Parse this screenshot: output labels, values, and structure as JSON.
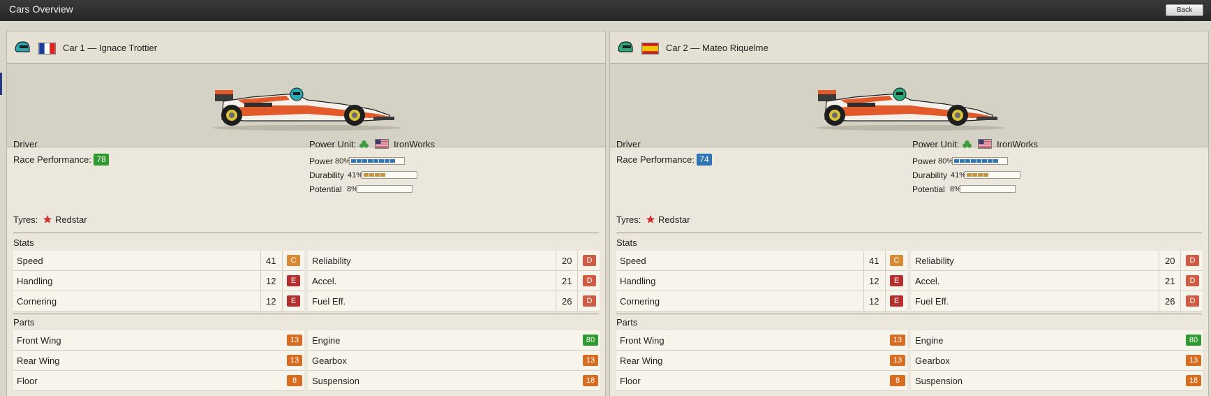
{
  "window": {
    "title": "Cars Overview",
    "back_label": "Back"
  },
  "colors": {
    "grade_C": "#d88933",
    "grade_D": "#cf5b45",
    "grade_E": "#b52f2f",
    "part_orange": "#d86d22",
    "part_green": "#2f9a2f",
    "power_bar": "#2f74b5",
    "durability_bar": "#c8913b"
  },
  "cars": [
    {
      "title": "Car 1 — Ignace Trottier",
      "flag": "france-flag",
      "helmet": "teal-helmet",
      "driver_label": "Driver",
      "race_perf_label": "Race Performance:",
      "race_perf_value": "78",
      "race_perf_color": "green",
      "power_unit_label": "Power Unit:",
      "power_unit_name": "IronWorks",
      "meters": [
        {
          "label": "Power",
          "pct": "80%",
          "fraction": 0.8,
          "kind": "power"
        },
        {
          "label": "Durability",
          "pct": "41%",
          "fraction": 0.41,
          "kind": "durability"
        },
        {
          "label": "Potential",
          "pct": "8%",
          "fraction": 0.08,
          "kind": "potential"
        }
      ],
      "tyres_label": "Tyres:",
      "tyres_name": "Redstar",
      "stats_label": "Stats",
      "stats_left": [
        {
          "name": "Speed",
          "value": "41",
          "grade": "C"
        },
        {
          "name": "Handling",
          "value": "12",
          "grade": "E"
        },
        {
          "name": "Cornering",
          "value": "12",
          "grade": "E"
        }
      ],
      "stats_right": [
        {
          "name": "Reliability",
          "value": "20",
          "grade": "D"
        },
        {
          "name": "Accel.",
          "value": "21",
          "grade": "D"
        },
        {
          "name": "Fuel Eff.",
          "value": "26",
          "grade": "D"
        }
      ],
      "parts_label": "Parts",
      "parts_left": [
        {
          "name": "Front Wing",
          "value": "13",
          "color": "orange"
        },
        {
          "name": "Rear Wing",
          "value": "13",
          "color": "orange"
        },
        {
          "name": "Floor",
          "value": "8",
          "color": "orange"
        }
      ],
      "parts_right": [
        {
          "name": "Engine",
          "value": "80",
          "color": "green"
        },
        {
          "name": "Gearbox",
          "value": "13",
          "color": "orange"
        },
        {
          "name": "Suspension",
          "value": "18",
          "color": "orange"
        }
      ]
    },
    {
      "title": "Car 2 — Mateo Riquelme",
      "flag": "spain-flag",
      "helmet": "green-helmet",
      "driver_label": "Driver",
      "race_perf_label": "Race Performance:",
      "race_perf_value": "74",
      "race_perf_color": "blue",
      "power_unit_label": "Power Unit:",
      "power_unit_name": "IronWorks",
      "meters": [
        {
          "label": "Power",
          "pct": "80%",
          "fraction": 0.8,
          "kind": "power"
        },
        {
          "label": "Durability",
          "pct": "41%",
          "fraction": 0.41,
          "kind": "durability"
        },
        {
          "label": "Potential",
          "pct": "8%",
          "fraction": 0.08,
          "kind": "potential"
        }
      ],
      "tyres_label": "Tyres:",
      "tyres_name": "Redstar",
      "stats_label": "Stats",
      "stats_left": [
        {
          "name": "Speed",
          "value": "41",
          "grade": "C"
        },
        {
          "name": "Handling",
          "value": "12",
          "grade": "E"
        },
        {
          "name": "Cornering",
          "value": "12",
          "grade": "E"
        }
      ],
      "stats_right": [
        {
          "name": "Reliability",
          "value": "20",
          "grade": "D"
        },
        {
          "name": "Accel.",
          "value": "21",
          "grade": "D"
        },
        {
          "name": "Fuel Eff.",
          "value": "26",
          "grade": "D"
        }
      ],
      "parts_label": "Parts",
      "parts_left": [
        {
          "name": "Front Wing",
          "value": "13",
          "color": "orange"
        },
        {
          "name": "Rear Wing",
          "value": "13",
          "color": "orange"
        },
        {
          "name": "Floor",
          "value": "8",
          "color": "orange"
        }
      ],
      "parts_right": [
        {
          "name": "Engine",
          "value": "80",
          "color": "green"
        },
        {
          "name": "Gearbox",
          "value": "13",
          "color": "orange"
        },
        {
          "name": "Suspension",
          "value": "18",
          "color": "orange"
        }
      ]
    }
  ]
}
